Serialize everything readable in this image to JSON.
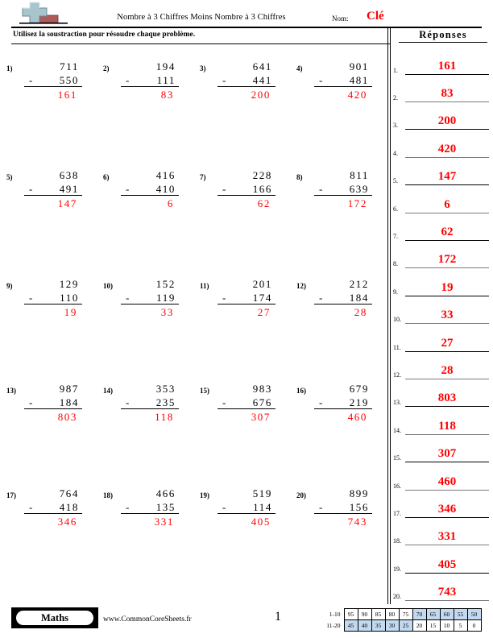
{
  "header": {
    "logo_icon": "plus-block-icon",
    "title": "Nombre à 3 Chiffres Moins Nombre à 3 Chiffres",
    "name_label": "Nom:",
    "name_value": "Clé",
    "instruction": "Utilisez la soustraction pour résoudre chaque problème.",
    "answers_heading": "Réponses"
  },
  "problems": [
    {
      "num": "1)",
      "minuend": "711",
      "operator": "-",
      "subtrahend": "550",
      "answer": "161"
    },
    {
      "num": "2)",
      "minuend": "194",
      "operator": "-",
      "subtrahend": "111",
      "answer": "83"
    },
    {
      "num": "3)",
      "minuend": "641",
      "operator": "-",
      "subtrahend": "441",
      "answer": "200"
    },
    {
      "num": "4)",
      "minuend": "901",
      "operator": "-",
      "subtrahend": "481",
      "answer": "420"
    },
    {
      "num": "5)",
      "minuend": "638",
      "operator": "-",
      "subtrahend": "491",
      "answer": "147"
    },
    {
      "num": "6)",
      "minuend": "416",
      "operator": "-",
      "subtrahend": "410",
      "answer": "6"
    },
    {
      "num": "7)",
      "minuend": "228",
      "operator": "-",
      "subtrahend": "166",
      "answer": "62"
    },
    {
      "num": "8)",
      "minuend": "811",
      "operator": "-",
      "subtrahend": "639",
      "answer": "172"
    },
    {
      "num": "9)",
      "minuend": "129",
      "operator": "-",
      "subtrahend": "110",
      "answer": "19"
    },
    {
      "num": "10)",
      "minuend": "152",
      "operator": "-",
      "subtrahend": "119",
      "answer": "33"
    },
    {
      "num": "11)",
      "minuend": "201",
      "operator": "-",
      "subtrahend": "174",
      "answer": "27"
    },
    {
      "num": "12)",
      "minuend": "212",
      "operator": "-",
      "subtrahend": "184",
      "answer": "28"
    },
    {
      "num": "13)",
      "minuend": "987",
      "operator": "-",
      "subtrahend": "184",
      "answer": "803"
    },
    {
      "num": "14)",
      "minuend": "353",
      "operator": "-",
      "subtrahend": "235",
      "answer": "118"
    },
    {
      "num": "15)",
      "minuend": "983",
      "operator": "-",
      "subtrahend": "676",
      "answer": "307"
    },
    {
      "num": "16)",
      "minuend": "679",
      "operator": "-",
      "subtrahend": "219",
      "answer": "460"
    },
    {
      "num": "17)",
      "minuend": "764",
      "operator": "-",
      "subtrahend": "418",
      "answer": "346"
    },
    {
      "num": "18)",
      "minuend": "466",
      "operator": "-",
      "subtrahend": "135",
      "answer": "331"
    },
    {
      "num": "19)",
      "minuend": "519",
      "operator": "-",
      "subtrahend": "114",
      "answer": "405"
    },
    {
      "num": "20)",
      "minuend": "899",
      "operator": "-",
      "subtrahend": "156",
      "answer": "743"
    }
  ],
  "answers": [
    {
      "num": "1.",
      "value": "161"
    },
    {
      "num": "2.",
      "value": "83"
    },
    {
      "num": "3.",
      "value": "200"
    },
    {
      "num": "4.",
      "value": "420"
    },
    {
      "num": "5.",
      "value": "147"
    },
    {
      "num": "6.",
      "value": "6"
    },
    {
      "num": "7.",
      "value": "62"
    },
    {
      "num": "8.",
      "value": "172"
    },
    {
      "num": "9.",
      "value": "19"
    },
    {
      "num": "10.",
      "value": "33"
    },
    {
      "num": "11.",
      "value": "27"
    },
    {
      "num": "12.",
      "value": "28"
    },
    {
      "num": "13.",
      "value": "803"
    },
    {
      "num": "14.",
      "value": "118"
    },
    {
      "num": "15.",
      "value": "307"
    },
    {
      "num": "16.",
      "value": "460"
    },
    {
      "num": "17.",
      "value": "346"
    },
    {
      "num": "18.",
      "value": "331"
    },
    {
      "num": "19.",
      "value": "405"
    },
    {
      "num": "20.",
      "value": "743"
    }
  ],
  "footer": {
    "brand": "Maths",
    "site": "www.CommonCoreSheets.fr",
    "page_number": "1",
    "score_table": {
      "rows": [
        {
          "label": "1-10",
          "cells": [
            {
              "value": "95",
              "highlight": false
            },
            {
              "value": "90",
              "highlight": false
            },
            {
              "value": "85",
              "highlight": false
            },
            {
              "value": "80",
              "highlight": false
            },
            {
              "value": "75",
              "highlight": false
            },
            {
              "value": "70",
              "highlight": true
            },
            {
              "value": "65",
              "highlight": true
            },
            {
              "value": "60",
              "highlight": true
            },
            {
              "value": "55",
              "highlight": true
            },
            {
              "value": "50",
              "highlight": true
            }
          ]
        },
        {
          "label": "11-20",
          "cells": [
            {
              "value": "45",
              "highlight": true
            },
            {
              "value": "40",
              "highlight": true
            },
            {
              "value": "35",
              "highlight": true
            },
            {
              "value": "30",
              "highlight": true
            },
            {
              "value": "25",
              "highlight": true
            },
            {
              "value": "20",
              "highlight": false
            },
            {
              "value": "15",
              "highlight": false
            },
            {
              "value": "10",
              "highlight": false
            },
            {
              "value": "5",
              "highlight": false
            },
            {
              "value": "0",
              "highlight": false
            }
          ]
        }
      ]
    }
  },
  "colors": {
    "answer_red": "#ff0000",
    "highlight_blue": "#c3d9f0",
    "logo_blue": "#a8c4cc",
    "logo_red": "#b05a5a"
  }
}
